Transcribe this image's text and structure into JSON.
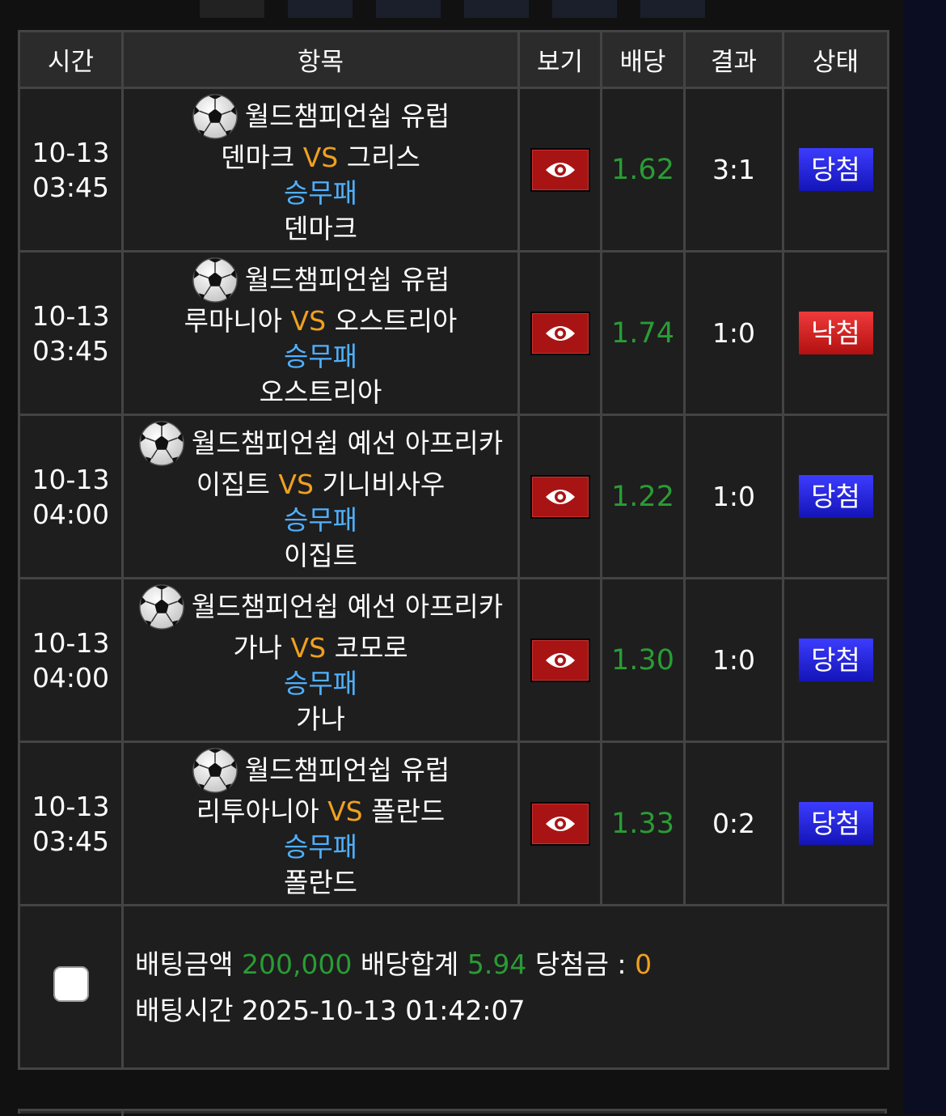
{
  "headers": {
    "time": "시간",
    "item": "항목",
    "view": "보기",
    "odds": "배당",
    "result": "결과",
    "status": "상태"
  },
  "vs_label": "VS",
  "bets": [
    {
      "date": "10-13",
      "clock": "03:45",
      "league": "월드챔피언쉽 유럽",
      "home": "덴마크",
      "away": "그리스",
      "market": "승무패",
      "pick": "덴마크",
      "odds": "1.62",
      "result": "3:1",
      "status": "당첨",
      "status_type": "win"
    },
    {
      "date": "10-13",
      "clock": "03:45",
      "league": "월드챔피언쉽 유럽",
      "home": "루마니아",
      "away": "오스트리아",
      "market": "승무패",
      "pick": "오스트리아",
      "odds": "1.74",
      "result": "1:0",
      "status": "낙첨",
      "status_type": "lose"
    },
    {
      "date": "10-13",
      "clock": "04:00",
      "league": "월드챔피언쉽 예선 아프리카",
      "home": "이집트",
      "away": "기니비사우",
      "market": "승무패",
      "pick": "이집트",
      "odds": "1.22",
      "result": "1:0",
      "status": "당첨",
      "status_type": "win"
    },
    {
      "date": "10-13",
      "clock": "04:00",
      "league": "월드챔피언쉽 예선 아프리카",
      "home": "가나",
      "away": "코모로",
      "market": "승무패",
      "pick": "가나",
      "odds": "1.30",
      "result": "1:0",
      "status": "당첨",
      "status_type": "win"
    },
    {
      "date": "10-13",
      "clock": "03:45",
      "league": "월드챔피언쉽 유럽",
      "home": "리투아니아",
      "away": "폴란드",
      "market": "승무패",
      "pick": "폴란드",
      "odds": "1.33",
      "result": "0:2",
      "status": "당첨",
      "status_type": "win"
    }
  ],
  "summary": {
    "bet_amount_label": "배팅금액",
    "bet_amount": "200,000",
    "total_odds_label": "배당합계",
    "total_odds": "5.94",
    "win_amount_label": "당첨금 :",
    "win_amount": "0",
    "bet_time_label": "배팅시간",
    "bet_time": "2025-10-13 01:42:07"
  },
  "icons": {
    "sport": "soccer-ball-icon",
    "view": "eye-icon"
  },
  "colors": {
    "odds": "#2a9c35",
    "vs": "#f0a020",
    "market": "#4fb0ff",
    "win": "#2323d8",
    "lose": "#d42222"
  }
}
